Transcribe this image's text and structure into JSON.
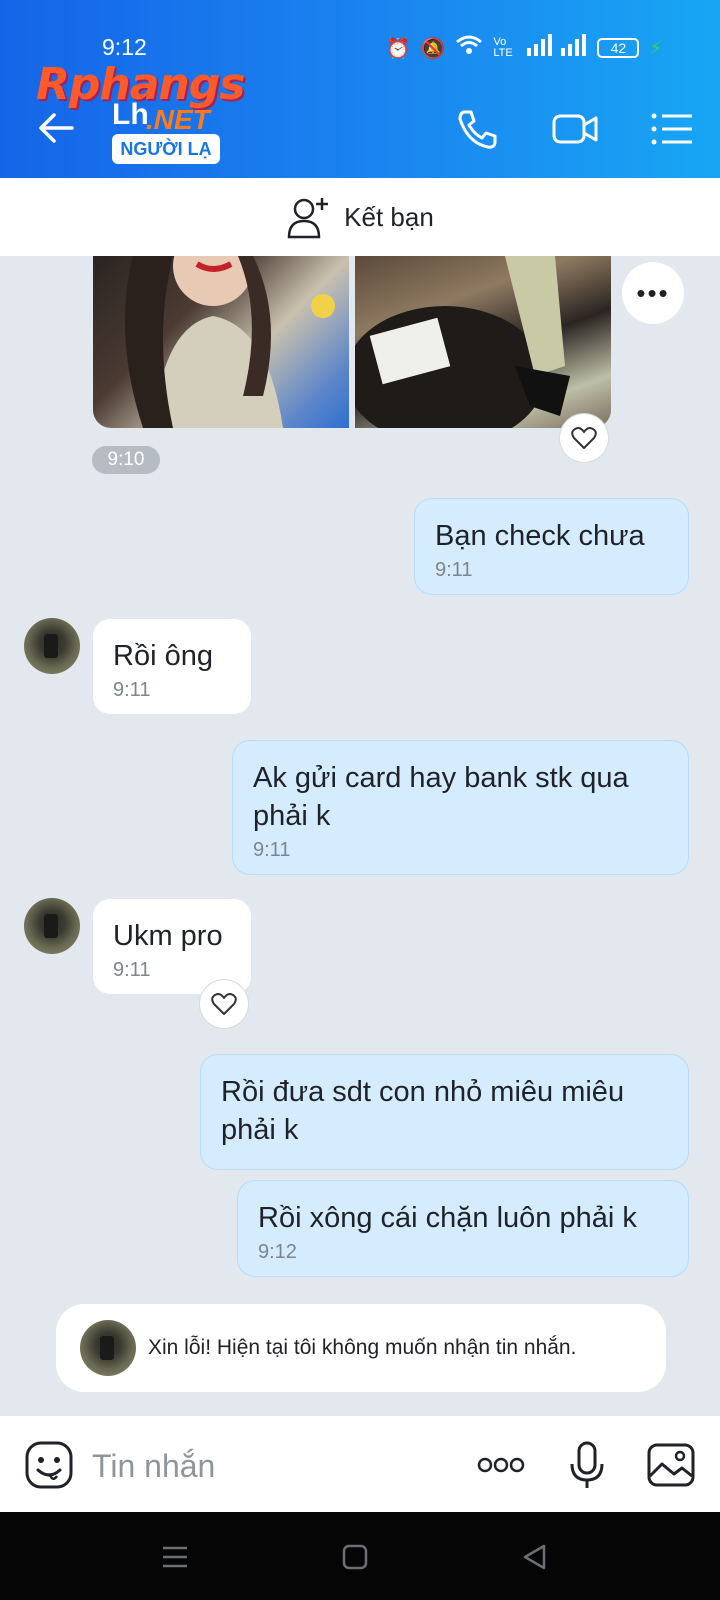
{
  "status_bar": {
    "time": "9:12",
    "battery": "42",
    "network": "Vo LTE"
  },
  "header": {
    "watermark": {
      "main": "Rphangs",
      "sub": "Lh",
      "net": ".NET"
    },
    "badge": "NGƯỜI LẠ",
    "icons": [
      "back-arrow-icon",
      "phone-icon",
      "video-call-icon",
      "menu-icon"
    ]
  },
  "add_friend": {
    "label": "Kết bạn"
  },
  "chat": {
    "photo_time": "9:10",
    "messages": [
      {
        "dir": "out",
        "text": "Bạn check chưa",
        "time": "9:11"
      },
      {
        "dir": "in",
        "text": "Rồi ông",
        "time": "9:11"
      },
      {
        "dir": "out",
        "text": "Ak gửi card hay bank stk qua phải k",
        "time": "9:11"
      },
      {
        "dir": "in",
        "text": "Ukm pro",
        "time": "9:11"
      },
      {
        "dir": "out",
        "text": "Rồi đưa sdt con nhỏ miêu miêu phải k",
        "time": ""
      },
      {
        "dir": "out",
        "text": "Rồi xông cái chặn luôn phải k",
        "time": "9:12"
      }
    ],
    "notice": "Xin lỗi! Hiện tại tôi không muốn nhận tin nhắn."
  },
  "input_bar": {
    "placeholder": "Tin nhắn"
  },
  "colors": {
    "header_start": "#1565e8",
    "header_end": "#18a6f4",
    "outgoing_bubble": "#d4ecfd",
    "chat_bg": "#e2e8ee"
  }
}
